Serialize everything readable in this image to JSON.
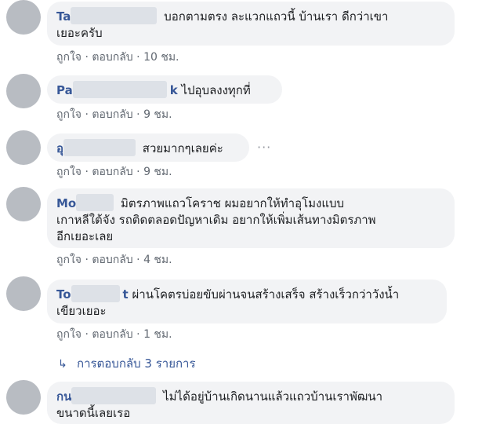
{
  "comments": [
    {
      "name_visible": "Ta",
      "text_line1": "บอกตามตรง ละแวกแถวนี้ บ้านเรา ดีกว่าเขา",
      "text_line2": "เยอะครับ",
      "like": "ถูกใจ",
      "reply": "ตอบกลับ",
      "time": "10 ชม."
    },
    {
      "name_visible": "Pa",
      "name_tail": "k",
      "text_line1": "ไปอุบลงงทุกที่",
      "like": "ถูกใจ",
      "reply": "ตอบกลับ",
      "time": "9 ชม."
    },
    {
      "name_visible": "อุ",
      "text_line1": "สวยมากๆเลยค่ะ",
      "like": "ถูกใจ",
      "reply": "ตอบกลับ",
      "time": "9 ชม.",
      "more": "···"
    },
    {
      "name_visible": "Mo",
      "text_line1": "มิตรภาพแถวโคราช ผมอยากให้ทำอุโมงแบบ",
      "text_line2": "เกาหลีใต้จัง รถติดตลอดปัญหาเดิม อยากให้เพิ่มเส้นทางมิตรภาพ",
      "text_line3": "อีกเยอะเลย",
      "like": "ถูกใจ",
      "reply": "ตอบกลับ",
      "time": "4 ชม."
    },
    {
      "name_visible": "To",
      "name_tail": "t",
      "text_line1": "ผ่านโคตรบ่อยขับผ่านจนสร้างเสร็จ สร้างเร็วกว่าวังน้ำ",
      "text_line2": "เขียวเยอะ",
      "like": "ถูกใจ",
      "reply": "ตอบกลับ",
      "time": "1 ชม."
    },
    {
      "name_visible": "กน",
      "text_line1": "ไม่ได้อยู่บ้านเกิดนานแล้วแถวบ้านเราพัฒนา",
      "text_line2": "ขนาดนี้เลยเรอ"
    }
  ],
  "replies_link": "การตอบกลับ 3 รายการ",
  "replies_arrow": "↳",
  "separator": "·"
}
